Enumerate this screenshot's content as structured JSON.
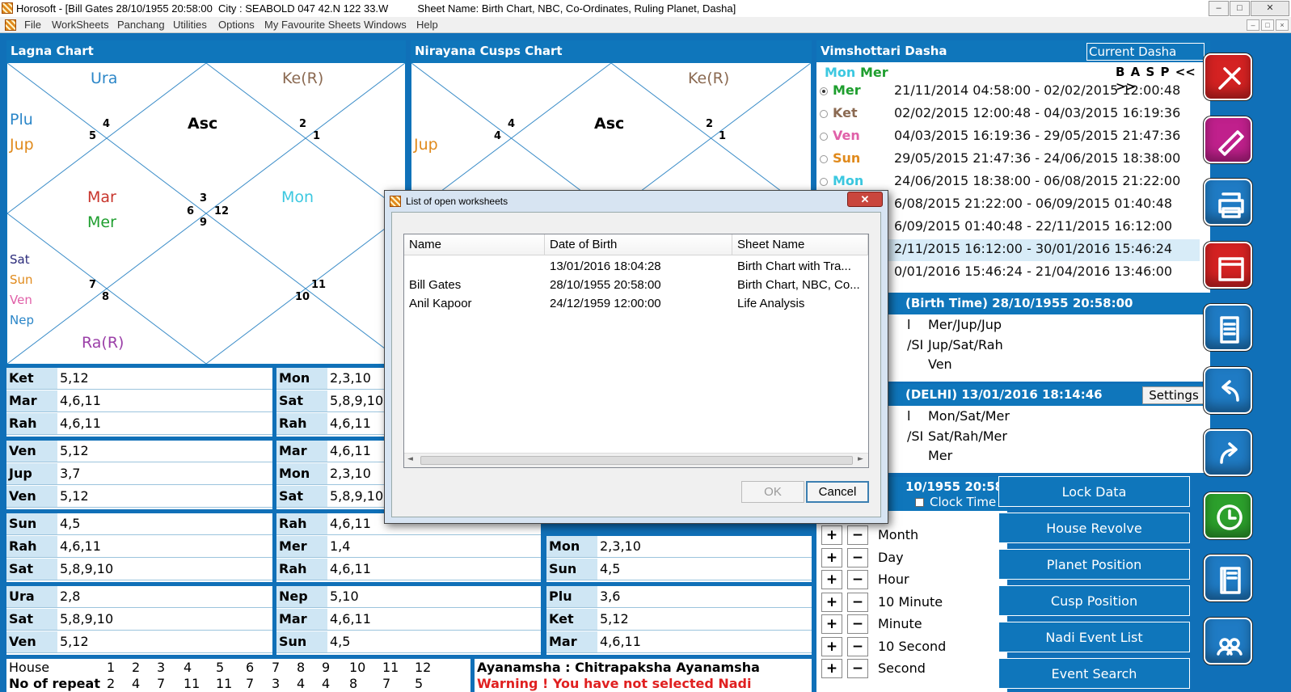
{
  "window": {
    "title": "Horosoft - [Bill Gates 28/10/1955 20:58:00  City : SEABOLD 047 42.N 122 33.W          Sheet Name: Birth Chart, NBC, Co-Ordinates, Ruling Planet, Dasha]",
    "menu": [
      "File",
      "WorkSheets",
      "Panchang",
      "Utilities",
      "Options",
      "My Favourite Sheets",
      "Windows",
      "Help"
    ],
    "win_buttons": [
      "–",
      "□",
      "✕"
    ],
    "mdi_buttons": [
      "–",
      "□",
      "×"
    ]
  },
  "lagna": {
    "title": "Lagna Chart",
    "planets": [
      {
        "t": "Ura",
        "c": "#2b86c8"
      },
      {
        "t": "Ke(R)",
        "c": "#8b6a52"
      },
      {
        "t": "Plu",
        "c": "#2b86c8"
      },
      {
        "t": "Jup",
        "c": "#e08a1c"
      },
      {
        "t": "Asc",
        "c": "#000000"
      },
      {
        "t": "Mar",
        "c": "#c8352c"
      },
      {
        "t": "Mer",
        "c": "#1e9e2e"
      },
      {
        "t": "Mon",
        "c": "#3cc8e0"
      },
      {
        "t": "Sat",
        "c": "#2a2a7a"
      },
      {
        "t": "Sun",
        "c": "#e08a1c"
      },
      {
        "t": "Ven",
        "c": "#e060a8"
      },
      {
        "t": "Nep",
        "c": "#2b86c8"
      },
      {
        "t": "Ra(R)",
        "c": "#9b40a8"
      }
    ],
    "houses": [
      "4",
      "5",
      "2",
      "1",
      "3",
      "6",
      "12",
      "9",
      "7",
      "8",
      "11",
      "10"
    ]
  },
  "cusps": {
    "title": "Nirayana Cusps Chart",
    "planets": [
      {
        "t": "Ke(R)",
        "c": "#8b6a52"
      },
      {
        "t": "Jup",
        "c": "#e08a1c"
      },
      {
        "t": "Asc",
        "c": "#000000"
      }
    ],
    "houses": [
      "4",
      "4",
      "2",
      "1"
    ]
  },
  "grid": [
    [
      [
        "Ket",
        "5,12"
      ],
      [
        "Mar",
        "4,6,11"
      ],
      [
        "Rah",
        "4,6,11"
      ]
    ],
    [
      [
        "Mon",
        "2,3,10"
      ],
      [
        "Sat",
        "5,8,9,10"
      ],
      [
        "Rah",
        "4,6,11"
      ]
    ],
    [
      [
        "Ven",
        "5,12"
      ],
      [
        "Jup",
        "3,7"
      ],
      [
        "Ven",
        "5,12"
      ]
    ],
    [
      [
        "Mar",
        "4,6,11"
      ],
      [
        "Mon",
        "2,3,10"
      ],
      [
        "Sat",
        "5,8,9,10"
      ]
    ],
    [
      [
        "Sun",
        "4,5"
      ],
      [
        "Rah",
        "4,6,11"
      ],
      [
        "Sat",
        "5,8,9,10"
      ]
    ],
    [
      [
        "Rah",
        "4,6,11"
      ],
      [
        "Mer",
        "1,4"
      ],
      [
        "Rah",
        "4,6,11"
      ]
    ],
    [
      [
        "Mon",
        "2,3,10"
      ],
      [
        "Sun",
        "4,5"
      ]
    ],
    [
      [
        "Ura",
        "2,8"
      ],
      [
        "Sat",
        "5,8,9,10"
      ],
      [
        "Ven",
        "5,12"
      ]
    ],
    [
      [
        "Nep",
        "5,10"
      ],
      [
        "Mar",
        "4,6,11"
      ],
      [
        "Sun",
        "4,5"
      ]
    ],
    [
      [
        "Plu",
        "3,6"
      ],
      [
        "Ket",
        "5,12"
      ],
      [
        "Mar",
        "4,6,11"
      ]
    ]
  ],
  "repeat": {
    "house_label": "House",
    "repeat_label": "No of repeat",
    "houses": [
      "1",
      "2",
      "3",
      "4",
      "5",
      "6",
      "7",
      "8",
      "9",
      "10",
      "11",
      "12"
    ],
    "counts": [
      "2",
      "4",
      "7",
      "11",
      "11",
      "7",
      "3",
      "4",
      "4",
      "8",
      "7",
      "5"
    ]
  },
  "ayan": {
    "line1": "Ayanamsha : Chitrapaksha Ayanamsha",
    "warning": "Warning ! You have not selected Nadi Ayanamsha"
  },
  "dasha": {
    "title": "Vimshottari Dasha",
    "current_label": "Current Dasha",
    "cur_a": "Mon",
    "cur_b": "Mer",
    "nav": "B A S P << >>",
    "rows": [
      {
        "p": "Mer",
        "c": "#1e9e2e",
        "d": "21/11/2014 04:58:00 - 02/02/2015 12:00:48"
      },
      {
        "p": "Ket",
        "c": "#8b6a52",
        "d": "02/02/2015 12:00:48 - 04/03/2015 16:19:36"
      },
      {
        "p": "Ven",
        "c": "#e060a8",
        "d": "04/03/2015 16:19:36 - 29/05/2015 21:47:36"
      },
      {
        "p": "Sun",
        "c": "#e08a1c",
        "d": "29/05/2015 21:47:36 - 24/06/2015 18:38:00"
      },
      {
        "p": "Mon",
        "c": "#3cc8e0",
        "d": "24/06/2015 18:38:00 - 06/08/2015 21:22:00"
      },
      {
        "p": "",
        "c": "#c8352c",
        "d": "6/08/2015 21:22:00 - 06/09/2015 01:40:48"
      },
      {
        "p": "",
        "c": "#c8352c",
        "d": "6/09/2015 01:40:48 - 22/11/2015 16:12:00"
      },
      {
        "p": "",
        "c": "#000",
        "d": "2/11/2015 16:12:00 - 30/01/2016 15:46:24"
      },
      {
        "p": "",
        "c": "#000",
        "d": "0/01/2016 15:46:24 - 21/04/2016 13:46:00"
      }
    ]
  },
  "ruling_birth": {
    "header": "(Birth Time) 28/10/1955 20:58:00",
    "rows": [
      [
        "l",
        "Mer/Jup/Jup"
      ],
      [
        "/SI",
        "Jup/Sat/Rah"
      ],
      [
        "",
        "Ven"
      ]
    ]
  },
  "ruling_now": {
    "header": "(DELHI) 13/01/2016 18:14:46",
    "settings": "Settings",
    "rows": [
      [
        "l",
        "Mon/Sat/Mer"
      ],
      [
        "/SI",
        "Sat/Rah/Mer"
      ],
      [
        "",
        "Mer"
      ]
    ]
  },
  "time_adj": {
    "header": "10/1955 20:58:0",
    "clock": "Clock Time",
    "rows": [
      "Month",
      "Day",
      "Hour",
      "10 Minute",
      "Minute",
      "10 Second",
      "Second"
    ]
  },
  "buttons": [
    "Lock Data",
    "House Revolve",
    "Planet Position",
    "Cusp Position",
    "Nadi Event List",
    "Event Search"
  ],
  "side_icons": [
    {
      "name": "tools-icon",
      "c": "#d42222"
    },
    {
      "name": "edit-icon",
      "c": "#c0208c"
    },
    {
      "name": "printer-icon",
      "c": "#1f7bc4"
    },
    {
      "name": "calendar-icon",
      "c": "#d42222"
    },
    {
      "name": "document-icon",
      "c": "#1f7bc4"
    },
    {
      "name": "back-arrow-icon",
      "c": "#1f7bc4"
    },
    {
      "name": "forward-arrow-icon",
      "c": "#1f7bc4"
    },
    {
      "name": "clock-icon",
      "c": "#2ca02c"
    },
    {
      "name": "notebook-icon",
      "c": "#1f7bc4"
    },
    {
      "name": "group-icon",
      "c": "#1f7bc4"
    }
  ],
  "dialog": {
    "title": "List of open worksheets",
    "headers": [
      "Name",
      "Date of Birth",
      "Sheet Name"
    ],
    "rows": [
      [
        "",
        "13/01/2016 18:04:28",
        "Birth Chart with Tra..."
      ],
      [
        "Bill Gates",
        "28/10/1955 20:58:00",
        "Birth Chart, NBC, Co..."
      ],
      [
        "Anil Kapoor",
        "24/12/1959 12:00:00",
        "Life Analysis"
      ]
    ],
    "ok": "OK",
    "cancel": "Cancel"
  }
}
